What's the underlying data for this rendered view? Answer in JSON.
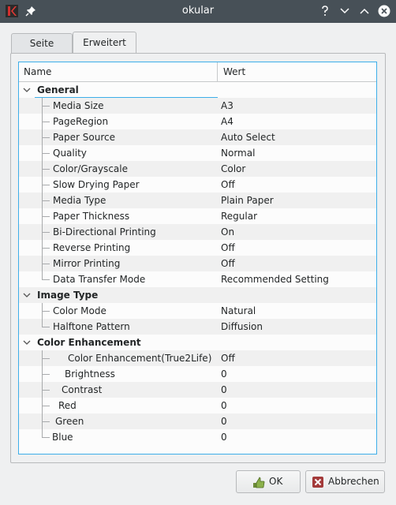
{
  "window": {
    "title": "okular"
  },
  "tabs": [
    {
      "label": "Seite",
      "active": false
    },
    {
      "label": "Erweitert",
      "active": true
    }
  ],
  "tree": {
    "columns": {
      "name": "Name",
      "value": "Wert"
    },
    "groups": [
      {
        "label": "General",
        "items": [
          {
            "name": "Media Size",
            "value": "A3"
          },
          {
            "name": "PageRegion",
            "value": "A4"
          },
          {
            "name": "Paper Source",
            "value": "Auto Select"
          },
          {
            "name": "Quality",
            "value": "Normal"
          },
          {
            "name": "Color/Grayscale",
            "value": "Color"
          },
          {
            "name": "Slow Drying Paper",
            "value": "Off"
          },
          {
            "name": "Media Type",
            "value": "Plain Paper"
          },
          {
            "name": "Paper Thickness",
            "value": "Regular"
          },
          {
            "name": "Bi-Directional Printing",
            "value": "On"
          },
          {
            "name": "Reverse Printing",
            "value": "Off"
          },
          {
            "name": "Mirror Printing",
            "value": "Off"
          },
          {
            "name": "Data Transfer Mode",
            "value": "Recommended Setting"
          }
        ]
      },
      {
        "label": "Image Type",
        "items": [
          {
            "name": "Color Mode",
            "value": "Natural"
          },
          {
            "name": "Halftone Pattern",
            "value": "Diffusion"
          }
        ]
      },
      {
        "label": "Color Enhancement",
        "items": [
          {
            "name": "Color Enhancement(True2Life)",
            "value": "Off"
          },
          {
            "name": "Brightness",
            "value": "0"
          },
          {
            "name": "Contrast",
            "value": "0"
          },
          {
            "name": "Red",
            "value": "0"
          },
          {
            "name": "Green",
            "value": "0"
          },
          {
            "name": "Blue",
            "value": "0"
          }
        ]
      }
    ]
  },
  "buttons": {
    "ok": "OK",
    "cancel": "Abbrechen"
  },
  "colors": {
    "titlebar": "#475057",
    "focus": "#3daee9",
    "window": "#eff0f1"
  },
  "icons": {
    "app": "okular-app-icon",
    "pin": "pin-icon",
    "help": "help-icon",
    "minimize": "chevron-down-icon",
    "maximize": "chevron-up-icon",
    "close": "close-icon",
    "ok": "checkmark-hand-icon",
    "cancel": "cancel-x-icon"
  }
}
